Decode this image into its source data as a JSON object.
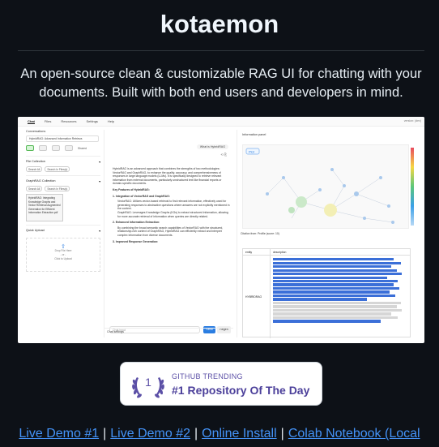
{
  "header": {
    "title": "kotaemon",
    "description": "An open-source clean & customizable RAG UI for chatting with your documents. Built with both end users and developers in mind."
  },
  "screenshot": {
    "nav": [
      "Chat",
      "Files",
      "Resources",
      "Settings",
      "Help"
    ],
    "version": "version: ​(dev)",
    "conversations_label": "Conversations",
    "conversation_selected": "HybridRAG: Advanced Information Retrieva",
    "shared_label": "Shared",
    "file_collection_label": "File Collection",
    "file_collection_options": [
      "Search All",
      "Search In Files(s)"
    ],
    "graphrag_collection_label": "GraphRAG Collection",
    "file_name": "HybridRAG: Integrating Knowledge Graphs and Vector Retrieval Augmented Generation for Efficient Information Extraction.pdf",
    "quick_upload_label": "Quick Upload",
    "upload_text": "Drop File Here",
    "upload_or": "- or -",
    "upload_click": "Click to Upload",
    "what_is": "What is HybridRAG",
    "answer_intro": "HybridRAG is an advanced approach that combines the strengths of two methodologies: VectorRAG and GraphRAG, to enhance the quality, accuracy, and comprehensiveness of responses in large language models (LLMs). It is specifically designed to retrieve relevant information from external documents, particularly unstructured text like financial reports or domain-specific documents.",
    "key_features": "Key Features of HybridRAG:",
    "features": [
      "1. Integration of VectorRAG and GraphRAG:",
      "VectorRAG: Utilizes vector-based retrieval to find relevant information, effectively used for generating responses to abstractive questions where answers are not explicitly mentioned in the context.",
      "GraphRAG: Leverages Knowledge Graphs (KGs) to extract structured information, allowing for more accurate retrieval of information when queries are directly related.",
      "2. Enhanced Information Extraction:",
      "By combining the broad semantic search capabilities of VectorRAG with the structured, relationship-rich context of GraphRAG, HybridRAG can efficiently extract and interpret complex information from diverse documents.",
      "3. Improved Response Generation:"
    ],
    "chat_placeholder": "Chat input",
    "send_label": "Send",
    "regen_label": "Regen",
    "chat_settings_label": "Chat settings",
    "info_panel_label": "Information panel",
    "plot_label": "Plot",
    "excerpt": "Citation from: Profile (score: 10)",
    "table_headers": [
      "entity",
      "description"
    ],
    "table_entity": "HYBRIDRAG"
  },
  "badge": {
    "rank": "1",
    "subtitle": "GITHUB TRENDING",
    "title": "#1 Repository Of The Day"
  },
  "links": [
    "Live Demo #1",
    "Live Demo #2",
    "Online Install",
    "Colab Notebook (Local"
  ],
  "colors": {
    "background": "#0d1117",
    "link": "#4493f8",
    "badge_text": "#4b3f9a",
    "accent_blue": "#2a7de1"
  }
}
